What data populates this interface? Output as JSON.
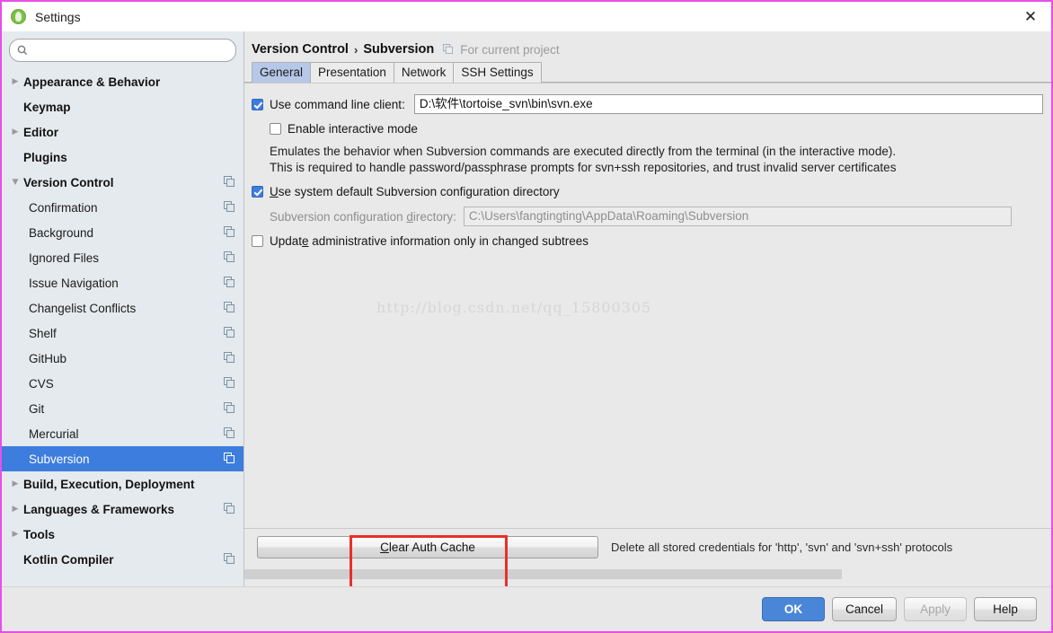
{
  "window": {
    "title": "Settings",
    "app_icon": "android-studio-icon",
    "close_icon": "close-icon",
    "border_color": "#e84fe8"
  },
  "sidebar": {
    "search": {
      "value": "",
      "placeholder": "",
      "icon": "search-icon"
    },
    "items": [
      {
        "label": "Appearance & Behavior",
        "level": "top",
        "arrow": "collapsed",
        "copy_icon": false,
        "selected": false
      },
      {
        "label": "Keymap",
        "level": "top",
        "arrow": "none",
        "copy_icon": false,
        "selected": false
      },
      {
        "label": "Editor",
        "level": "top",
        "arrow": "collapsed",
        "copy_icon": false,
        "selected": false
      },
      {
        "label": "Plugins",
        "level": "top",
        "arrow": "none",
        "copy_icon": false,
        "selected": false
      },
      {
        "label": "Version Control",
        "level": "top",
        "arrow": "expanded",
        "copy_icon": true,
        "selected": false
      },
      {
        "label": "Confirmation",
        "level": "child",
        "arrow": "none",
        "copy_icon": true,
        "selected": false
      },
      {
        "label": "Background",
        "level": "child",
        "arrow": "none",
        "copy_icon": true,
        "selected": false
      },
      {
        "label": "Ignored Files",
        "level": "child",
        "arrow": "none",
        "copy_icon": true,
        "selected": false
      },
      {
        "label": "Issue Navigation",
        "level": "child",
        "arrow": "none",
        "copy_icon": true,
        "selected": false
      },
      {
        "label": "Changelist Conflicts",
        "level": "child",
        "arrow": "none",
        "copy_icon": true,
        "selected": false
      },
      {
        "label": "Shelf",
        "level": "child",
        "arrow": "none",
        "copy_icon": true,
        "selected": false
      },
      {
        "label": "GitHub",
        "level": "child",
        "arrow": "none",
        "copy_icon": true,
        "selected": false
      },
      {
        "label": "CVS",
        "level": "child",
        "arrow": "none",
        "copy_icon": true,
        "selected": false
      },
      {
        "label": "Git",
        "level": "child",
        "arrow": "none",
        "copy_icon": true,
        "selected": false
      },
      {
        "label": "Mercurial",
        "level": "child",
        "arrow": "none",
        "copy_icon": true,
        "selected": false
      },
      {
        "label": "Subversion",
        "level": "child",
        "arrow": "none",
        "copy_icon": true,
        "selected": true
      },
      {
        "label": "Build, Execution, Deployment",
        "level": "top",
        "arrow": "collapsed",
        "copy_icon": false,
        "selected": false
      },
      {
        "label": "Languages & Frameworks",
        "level": "top",
        "arrow": "collapsed",
        "copy_icon": true,
        "selected": false
      },
      {
        "label": "Tools",
        "level": "top",
        "arrow": "collapsed",
        "copy_icon": false,
        "selected": false
      },
      {
        "label": "Kotlin Compiler",
        "level": "top",
        "arrow": "none",
        "copy_icon": true,
        "selected": false
      }
    ],
    "selection_color": "#3d7ddd"
  },
  "content": {
    "breadcrumb": {
      "parent": "Version Control",
      "separator": "›",
      "current": "Subversion",
      "scope_icon": "project-scope-icon",
      "scope_note": "For current project"
    },
    "tabs": [
      {
        "label": "General",
        "active": true
      },
      {
        "label": "Presentation",
        "active": false
      },
      {
        "label": "Network",
        "active": false
      },
      {
        "label": "SSH Settings",
        "active": false
      }
    ],
    "command_line": {
      "checkbox_label": "Use command line client:",
      "checked": true,
      "path_value": "D:\\软件\\tortoise_svn\\bin\\svn.exe"
    },
    "interactive_mode": {
      "checkbox_label": "Enable interactive mode",
      "checked": false
    },
    "description_line1": "Emulates the behavior when Subversion commands are executed directly from the terminal (in the interactive mode).",
    "description_line2": "This is required to handle password/passphrase prompts for svn+ssh repositories, and trust invalid server certificates",
    "system_default": {
      "checkbox_label": "Use system default Subversion configuration directory",
      "checked": true
    },
    "config_directory": {
      "label": "Subversion configuration directory:",
      "value": "C:\\Users\\fangtingting\\AppData\\Roaming\\Subversion",
      "disabled": true
    },
    "update_admin": {
      "checkbox_label": "Update administrative information only in changed subtrees",
      "checked": false
    },
    "watermark": "http://blog.csdn.net/qq_15800305",
    "clear_auth": {
      "button_label": "Clear Auth Cache",
      "note": "Delete all stored credentials for 'http', 'svn' and 'svn+ssh' protocols",
      "highlight_color": "#e8302b"
    }
  },
  "footer": {
    "ok": "OK",
    "cancel": "Cancel",
    "apply": "Apply",
    "apply_disabled": true,
    "help": "Help",
    "primary_color": "#4a86d8"
  }
}
